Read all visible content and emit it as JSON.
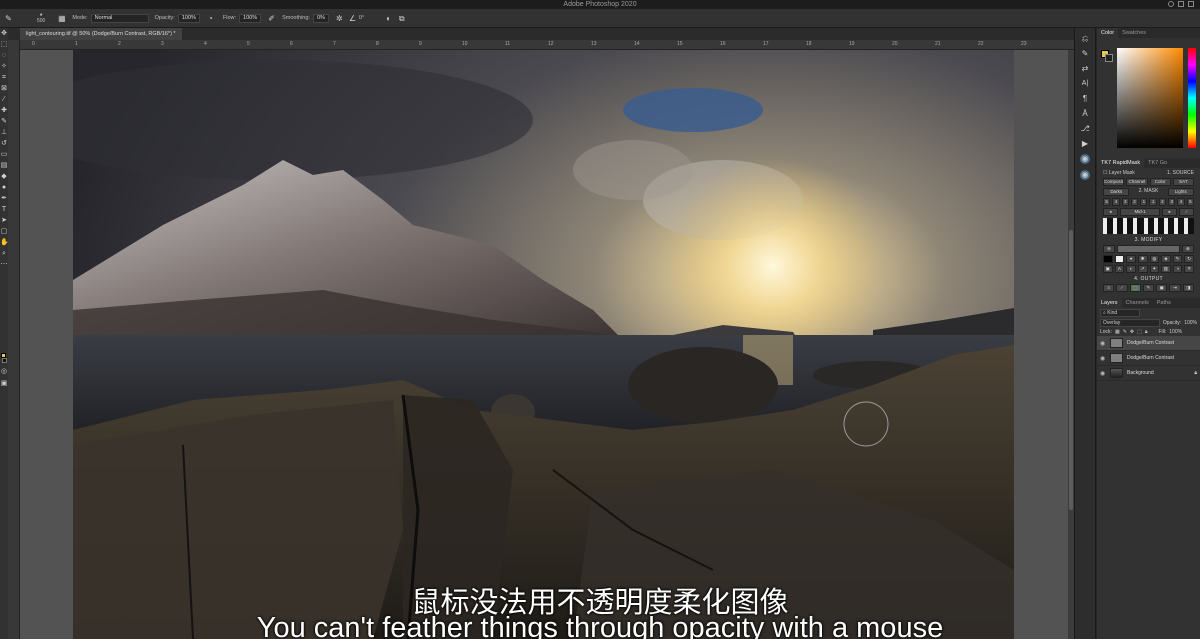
{
  "app": {
    "title": "Adobe Photoshop 2020"
  },
  "options_bar": {
    "brush_size": "500",
    "mode_label": "Mode:",
    "mode_value": "Normal",
    "opacity_label": "Opacity:",
    "opacity_value": "100%",
    "flow_label": "Flow:",
    "flow_value": "100%",
    "smoothing_label": "Smoothing:",
    "smoothing_value": "0%",
    "angle_value": "0°"
  },
  "document": {
    "tab_label": "light_contouring.tif @ 50% (Dodge/Burn Contrast, RGB/16*) *"
  },
  "ruler": {
    "ticks": [
      "0",
      "1",
      "2",
      "3",
      "4",
      "5",
      "6",
      "7",
      "8",
      "9",
      "10",
      "11",
      "12",
      "13",
      "14",
      "15",
      "16",
      "17",
      "18",
      "19",
      "20",
      "21",
      "22",
      "23"
    ]
  },
  "color_panel": {
    "tabs": [
      "Color",
      "Swatches"
    ],
    "fg_color": "#e8c94f",
    "bg_color": "#222222"
  },
  "rapidmask": {
    "tabs": [
      "TK7 RapidMask",
      "TK7 Go"
    ],
    "layer_mask_label": "Layer Mask",
    "source_label": "1. SOURCE",
    "source_buttons": [
      "Composite",
      "Channel",
      "Color",
      "SAT"
    ],
    "mask_label": "2. MASK",
    "mask_left": "Darks",
    "mask_right": "Lights",
    "num_buttons": [
      "5",
      "4",
      "3",
      "2",
      "1",
      "1",
      "2",
      "3",
      "4",
      "5"
    ],
    "midtones_label": "Mid-1",
    "modify_label": "3. MODIFY",
    "output_label": "4. OUTPUT"
  },
  "layers_panel": {
    "tabs": [
      "Layers",
      "Channels",
      "Paths"
    ],
    "filter_label": "Kind",
    "blend_mode": "Overlay",
    "opacity_label": "Opacity:",
    "opacity_value": "100%",
    "lock_label": "Lock:",
    "fill_label": "Fill:",
    "fill_value": "100%",
    "layers": [
      {
        "name": "Dodge/Burn Contrast",
        "selected": true
      },
      {
        "name": "Dodge/Burn Contrast",
        "selected": false
      },
      {
        "name": "Background",
        "selected": false
      }
    ]
  },
  "subtitles": {
    "chinese": "鼠标没法用不透明度柔化图像",
    "english": "You can't feather things through opacity with a mouse"
  }
}
